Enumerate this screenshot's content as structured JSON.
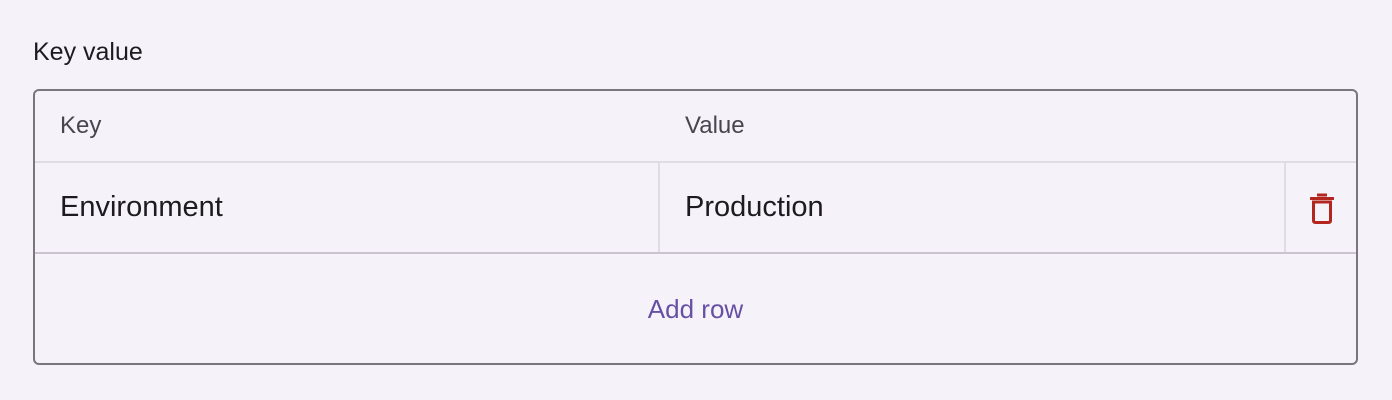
{
  "field": {
    "label": "Key value"
  },
  "table": {
    "headers": {
      "key": "Key",
      "value": "Value"
    },
    "rows": [
      {
        "key": "Environment",
        "value": "Production",
        "action_icon": "trash-icon"
      }
    ],
    "add_row_label": "Add row"
  },
  "colors": {
    "background": "#f6f2f9",
    "border": "#7a7680",
    "accent": "#6750a4",
    "delete": "#b3261e"
  }
}
